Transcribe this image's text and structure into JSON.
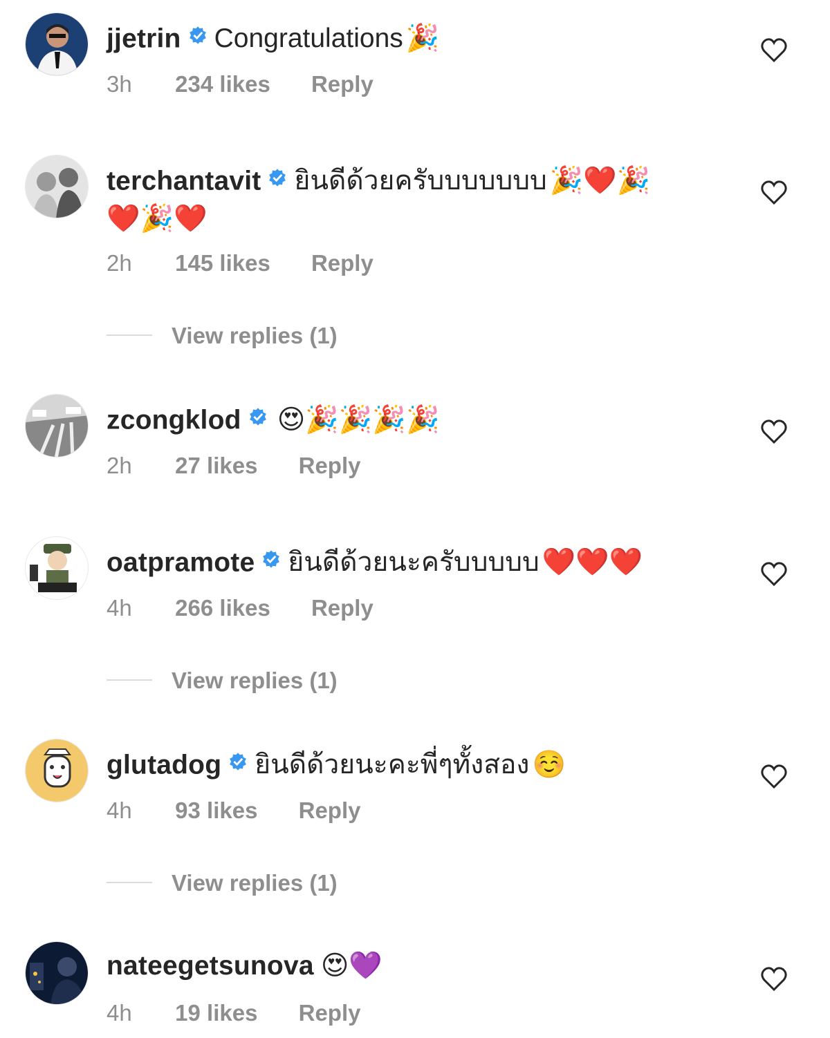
{
  "comments": [
    {
      "username": "jjetrin",
      "verified": true,
      "text": "Congratulations",
      "emojis": "🎉",
      "time": "3h",
      "likes": "234 likes",
      "reply_label": "Reply",
      "avatar": "avatar-jjetrin"
    },
    {
      "username": "terchantavit",
      "verified": true,
      "text": "ยินดีด้วยครับบบบบบบ",
      "emojis": "🎉❤️🎉",
      "emojis_line2": "❤️🎉❤️",
      "time": "2h",
      "likes": "145 likes",
      "reply_label": "Reply",
      "view_replies": "View replies (1)",
      "avatar": "avatar-terchantavit"
    },
    {
      "username": "zcongklod",
      "verified": true,
      "text": "",
      "emojis": "😍🎉🎉🎉🎉",
      "time": "2h",
      "likes": "27 likes",
      "reply_label": "Reply",
      "avatar": "avatar-zcongklod"
    },
    {
      "username": "oatpramote",
      "verified": true,
      "text": "ยินดีด้วยนะครับบบบบ",
      "emojis": "❤️❤️❤️",
      "time": "4h",
      "likes": "266 likes",
      "reply_label": "Reply",
      "view_replies": "View replies (1)",
      "avatar": "avatar-oatpramote"
    },
    {
      "username": "glutadog",
      "verified": true,
      "text": "ยินดีด้วยนะคะพี่ๆทั้งสอง",
      "emojis": "☺️",
      "time": "4h",
      "likes": "93 likes",
      "reply_label": "Reply",
      "view_replies": "View replies (1)",
      "avatar": "avatar-glutadog"
    },
    {
      "username": "nateegetsunova",
      "verified": false,
      "text": "",
      "emojis": "😍💜",
      "time": "4h",
      "likes": "19 likes",
      "reply_label": "Reply",
      "avatar": "avatar-nateegetsunova"
    }
  ],
  "colors": {
    "text": "#262626",
    "muted": "#8e8e8e",
    "verified": "#3897f0",
    "divider": "#dbdbdb"
  },
  "icons": {
    "verified": "verified-badge-icon",
    "like": "heart-outline-icon"
  }
}
